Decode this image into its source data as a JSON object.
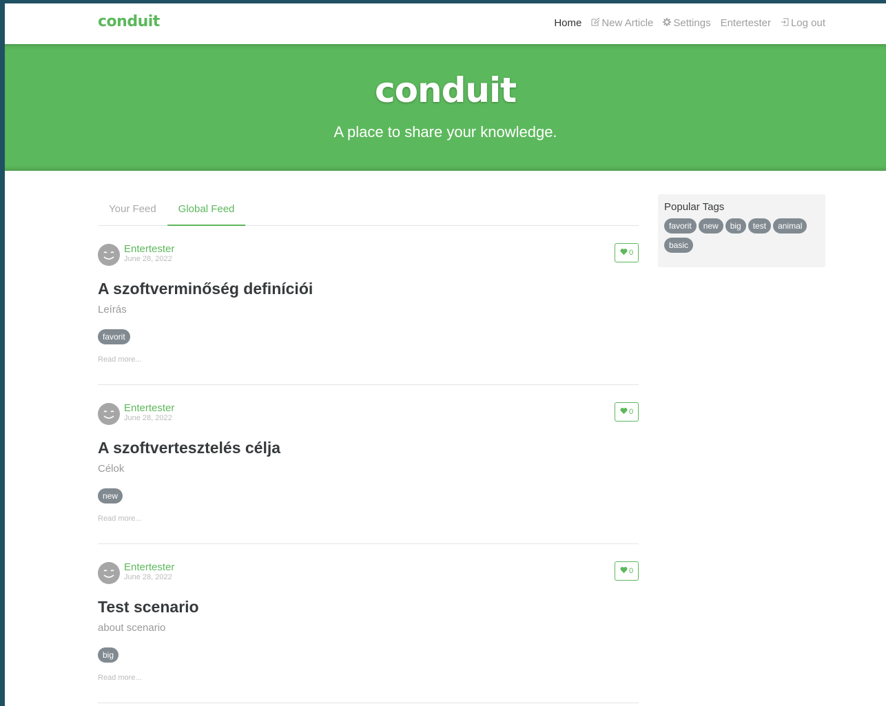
{
  "navbar": {
    "brand": "conduit",
    "links": [
      {
        "label": "Home",
        "icon": "",
        "active": true
      },
      {
        "label": "New Article",
        "icon": "edit-icon"
      },
      {
        "label": "Settings",
        "icon": "gear-icon"
      },
      {
        "label": "Entertester",
        "icon": ""
      },
      {
        "label": "Log out",
        "icon": "logout-icon"
      }
    ]
  },
  "banner": {
    "title": "conduit",
    "subtitle": "A place to share your knowledge."
  },
  "tabs": [
    {
      "label": "Your Feed",
      "active": false
    },
    {
      "label": "Global Feed",
      "active": true
    }
  ],
  "articles": [
    {
      "author": "Entertester",
      "date": "June 28, 2022",
      "likes": "0",
      "title": "A szoftverminőség definíciói",
      "description": "Leírás",
      "tag": "favorit",
      "read_more": "Read more..."
    },
    {
      "author": "Entertester",
      "date": "June 28, 2022",
      "likes": "0",
      "title": "A szoftvertesztelés célja",
      "description": "Célok",
      "tag": "new",
      "read_more": "Read more..."
    },
    {
      "author": "Entertester",
      "date": "June 28, 2022",
      "likes": "0",
      "title": "Test scenario",
      "description": "about scenario",
      "tag": "big",
      "read_more": "Read more..."
    }
  ],
  "sidebar": {
    "title": "Popular Tags",
    "tags": [
      "favorit",
      "new",
      "big",
      "test",
      "animal",
      "basic"
    ]
  },
  "colors": {
    "accent": "#5cb85c",
    "tag_bg": "#818a91"
  }
}
